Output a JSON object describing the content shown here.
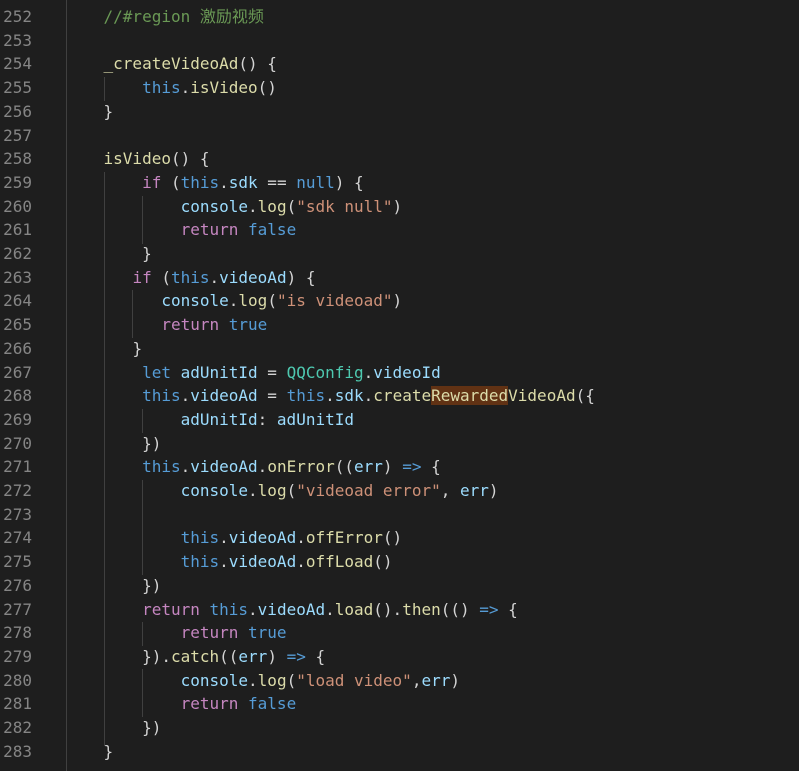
{
  "editor": {
    "lines": [
      {
        "num": "252",
        "indent": "    ",
        "tokens": [
          {
            "t": "//#region 激励视频",
            "c": "comment"
          }
        ]
      },
      {
        "num": "253",
        "indent": "",
        "tokens": []
      },
      {
        "num": "254",
        "indent": "    ",
        "tokens": [
          {
            "t": "_createVideoAd",
            "c": "fn"
          },
          {
            "t": "() {",
            "c": "op"
          }
        ]
      },
      {
        "num": "255",
        "indent": "        ",
        "tokens": [
          {
            "t": "this",
            "c": "kw"
          },
          {
            "t": ".",
            "c": "op"
          },
          {
            "t": "isVideo",
            "c": "fn"
          },
          {
            "t": "()",
            "c": "op"
          }
        ]
      },
      {
        "num": "256",
        "indent": "    ",
        "tokens": [
          {
            "t": "}",
            "c": "op"
          }
        ]
      },
      {
        "num": "257",
        "indent": "",
        "tokens": []
      },
      {
        "num": "258",
        "indent": "    ",
        "tokens": [
          {
            "t": "isVideo",
            "c": "fn"
          },
          {
            "t": "() {",
            "c": "op"
          }
        ]
      },
      {
        "num": "259",
        "indent": "        ",
        "tokens": [
          {
            "t": "if",
            "c": "ctrl"
          },
          {
            "t": " (",
            "c": "op"
          },
          {
            "t": "this",
            "c": "kw"
          },
          {
            "t": ".",
            "c": "op"
          },
          {
            "t": "sdk",
            "c": "var"
          },
          {
            "t": " == ",
            "c": "op"
          },
          {
            "t": "null",
            "c": "kw"
          },
          {
            "t": ") {",
            "c": "op"
          }
        ]
      },
      {
        "num": "260",
        "indent": "            ",
        "tokens": [
          {
            "t": "console",
            "c": "var"
          },
          {
            "t": ".",
            "c": "op"
          },
          {
            "t": "log",
            "c": "fn"
          },
          {
            "t": "(",
            "c": "op"
          },
          {
            "t": "\"sdk null\"",
            "c": "str"
          },
          {
            "t": ")",
            "c": "op"
          }
        ]
      },
      {
        "num": "261",
        "indent": "            ",
        "tokens": [
          {
            "t": "return",
            "c": "ctrl"
          },
          {
            "t": " ",
            "c": "op"
          },
          {
            "t": "false",
            "c": "kw"
          }
        ]
      },
      {
        "num": "262",
        "indent": "        ",
        "tokens": [
          {
            "t": "}",
            "c": "op"
          }
        ]
      },
      {
        "num": "263",
        "indent": "       ",
        "tokens": [
          {
            "t": "if",
            "c": "ctrl"
          },
          {
            "t": " (",
            "c": "op"
          },
          {
            "t": "this",
            "c": "kw"
          },
          {
            "t": ".",
            "c": "op"
          },
          {
            "t": "videoAd",
            "c": "var"
          },
          {
            "t": ") {",
            "c": "op"
          }
        ]
      },
      {
        "num": "264",
        "indent": "          ",
        "tokens": [
          {
            "t": "console",
            "c": "var"
          },
          {
            "t": ".",
            "c": "op"
          },
          {
            "t": "log",
            "c": "fn"
          },
          {
            "t": "(",
            "c": "op"
          },
          {
            "t": "\"is videoad\"",
            "c": "str"
          },
          {
            "t": ")",
            "c": "op"
          }
        ]
      },
      {
        "num": "265",
        "indent": "          ",
        "tokens": [
          {
            "t": "return",
            "c": "ctrl"
          },
          {
            "t": " ",
            "c": "op"
          },
          {
            "t": "true",
            "c": "kw"
          }
        ]
      },
      {
        "num": "266",
        "indent": "       ",
        "tokens": [
          {
            "t": "}",
            "c": "op"
          }
        ]
      },
      {
        "num": "267",
        "indent": "        ",
        "tokens": [
          {
            "t": "let",
            "c": "kw"
          },
          {
            "t": " ",
            "c": "op"
          },
          {
            "t": "adUnitId",
            "c": "var"
          },
          {
            "t": " = ",
            "c": "op"
          },
          {
            "t": "QQConfig",
            "c": "cls"
          },
          {
            "t": ".",
            "c": "op"
          },
          {
            "t": "videoId",
            "c": "var"
          }
        ]
      },
      {
        "num": "268",
        "indent": "        ",
        "tokens": [
          {
            "t": "this",
            "c": "kw"
          },
          {
            "t": ".",
            "c": "op"
          },
          {
            "t": "videoAd",
            "c": "var"
          },
          {
            "t": " = ",
            "c": "op"
          },
          {
            "t": "this",
            "c": "kw"
          },
          {
            "t": ".",
            "c": "op"
          },
          {
            "t": "sdk",
            "c": "var"
          },
          {
            "t": ".",
            "c": "op"
          },
          {
            "t": "create",
            "c": "fn"
          },
          {
            "t": "Rewarded",
            "c": "fn",
            "hl": true
          },
          {
            "t": "VideoAd",
            "c": "fn"
          },
          {
            "t": "({",
            "c": "op"
          }
        ]
      },
      {
        "num": "269",
        "indent": "            ",
        "tokens": [
          {
            "t": "adUnitId",
            "c": "var"
          },
          {
            "t": ": ",
            "c": "op"
          },
          {
            "t": "adUnitId",
            "c": "var"
          }
        ]
      },
      {
        "num": "270",
        "indent": "        ",
        "tokens": [
          {
            "t": "})",
            "c": "op"
          }
        ]
      },
      {
        "num": "271",
        "indent": "        ",
        "tokens": [
          {
            "t": "this",
            "c": "kw"
          },
          {
            "t": ".",
            "c": "op"
          },
          {
            "t": "videoAd",
            "c": "var"
          },
          {
            "t": ".",
            "c": "op"
          },
          {
            "t": "onError",
            "c": "fn"
          },
          {
            "t": "((",
            "c": "op"
          },
          {
            "t": "err",
            "c": "var"
          },
          {
            "t": ") ",
            "c": "op"
          },
          {
            "t": "=>",
            "c": "kw"
          },
          {
            "t": " {",
            "c": "op"
          }
        ]
      },
      {
        "num": "272",
        "indent": "            ",
        "tokens": [
          {
            "t": "console",
            "c": "var"
          },
          {
            "t": ".",
            "c": "op"
          },
          {
            "t": "log",
            "c": "fn"
          },
          {
            "t": "(",
            "c": "op"
          },
          {
            "t": "\"videoad error\"",
            "c": "str"
          },
          {
            "t": ", ",
            "c": "op"
          },
          {
            "t": "err",
            "c": "var"
          },
          {
            "t": ")",
            "c": "op"
          }
        ]
      },
      {
        "num": "273",
        "indent": "",
        "tokens": []
      },
      {
        "num": "274",
        "indent": "            ",
        "tokens": [
          {
            "t": "this",
            "c": "kw"
          },
          {
            "t": ".",
            "c": "op"
          },
          {
            "t": "videoAd",
            "c": "var"
          },
          {
            "t": ".",
            "c": "op"
          },
          {
            "t": "offError",
            "c": "fn"
          },
          {
            "t": "()",
            "c": "op"
          }
        ]
      },
      {
        "num": "275",
        "indent": "            ",
        "tokens": [
          {
            "t": "this",
            "c": "kw"
          },
          {
            "t": ".",
            "c": "op"
          },
          {
            "t": "videoAd",
            "c": "var"
          },
          {
            "t": ".",
            "c": "op"
          },
          {
            "t": "offLoad",
            "c": "fn"
          },
          {
            "t": "()",
            "c": "op"
          }
        ]
      },
      {
        "num": "276",
        "indent": "        ",
        "tokens": [
          {
            "t": "})",
            "c": "op"
          }
        ]
      },
      {
        "num": "277",
        "indent": "        ",
        "tokens": [
          {
            "t": "return",
            "c": "ctrl"
          },
          {
            "t": " ",
            "c": "op"
          },
          {
            "t": "this",
            "c": "kw"
          },
          {
            "t": ".",
            "c": "op"
          },
          {
            "t": "videoAd",
            "c": "var"
          },
          {
            "t": ".",
            "c": "op"
          },
          {
            "t": "load",
            "c": "fn"
          },
          {
            "t": "().",
            "c": "op"
          },
          {
            "t": "then",
            "c": "fn"
          },
          {
            "t": "(() ",
            "c": "op"
          },
          {
            "t": "=>",
            "c": "kw"
          },
          {
            "t": " {",
            "c": "op"
          }
        ]
      },
      {
        "num": "278",
        "indent": "            ",
        "tokens": [
          {
            "t": "return",
            "c": "ctrl"
          },
          {
            "t": " ",
            "c": "op"
          },
          {
            "t": "true",
            "c": "kw"
          }
        ]
      },
      {
        "num": "279",
        "indent": "        ",
        "tokens": [
          {
            "t": "}).",
            "c": "op"
          },
          {
            "t": "catch",
            "c": "fn"
          },
          {
            "t": "((",
            "c": "op"
          },
          {
            "t": "err",
            "c": "var"
          },
          {
            "t": ") ",
            "c": "op"
          },
          {
            "t": "=>",
            "c": "kw"
          },
          {
            "t": " {",
            "c": "op"
          }
        ]
      },
      {
        "num": "280",
        "indent": "            ",
        "tokens": [
          {
            "t": "console",
            "c": "var"
          },
          {
            "t": ".",
            "c": "op"
          },
          {
            "t": "log",
            "c": "fn"
          },
          {
            "t": "(",
            "c": "op"
          },
          {
            "t": "\"load video\"",
            "c": "str"
          },
          {
            "t": ",",
            "c": "op"
          },
          {
            "t": "err",
            "c": "var"
          },
          {
            "t": ")",
            "c": "op"
          }
        ]
      },
      {
        "num": "281",
        "indent": "            ",
        "tokens": [
          {
            "t": "return",
            "c": "ctrl"
          },
          {
            "t": " ",
            "c": "op"
          },
          {
            "t": "false",
            "c": "kw"
          }
        ]
      },
      {
        "num": "282",
        "indent": "        ",
        "tokens": [
          {
            "t": "})",
            "c": "op"
          }
        ]
      },
      {
        "num": "283",
        "indent": "    ",
        "tokens": [
          {
            "t": "}",
            "c": "op"
          }
        ]
      }
    ]
  }
}
